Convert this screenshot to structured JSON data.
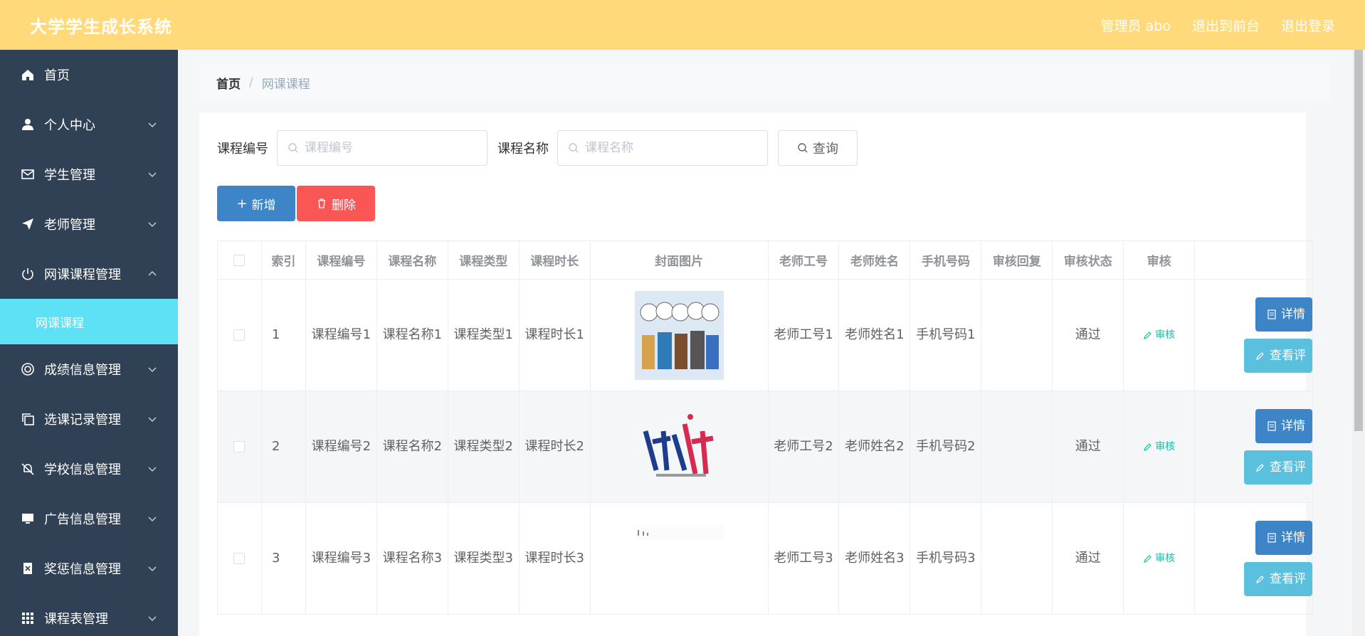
{
  "header": {
    "brand": "大学学生成长系统",
    "admin_label": "管理员 abo",
    "front_label": "退出到前台",
    "logout_label": "退出登录"
  },
  "sidebar": {
    "items": [
      {
        "label": "首页",
        "icon": "home-icon"
      },
      {
        "label": "个人中心",
        "icon": "user-icon"
      },
      {
        "label": "学生管理",
        "icon": "mail-icon"
      },
      {
        "label": "老师管理",
        "icon": "send-icon"
      },
      {
        "label": "网课课程管理",
        "icon": "power-icon"
      },
      {
        "label": "网课课程",
        "icon": ""
      },
      {
        "label": "成绩信息管理",
        "icon": "lifebuoy-icon"
      },
      {
        "label": "选课记录管理",
        "icon": "copy-icon"
      },
      {
        "label": "学校信息管理",
        "icon": "bell-off-icon"
      },
      {
        "label": "广告信息管理",
        "icon": "monitor-icon"
      },
      {
        "label": "奖惩信息管理",
        "icon": "delete-doc-icon"
      },
      {
        "label": "课程表管理",
        "icon": "grid-icon"
      }
    ]
  },
  "breadcrumb": {
    "home": "首页",
    "sep": "/",
    "current": "网课课程"
  },
  "search": {
    "code_label": "课程编号",
    "code_placeholder": "课程编号",
    "name_label": "课程名称",
    "name_placeholder": "课程名称",
    "query_label": "查询"
  },
  "actions": {
    "add_label": "新增",
    "delete_label": "删除"
  },
  "table": {
    "headers": [
      "索引",
      "课程编号",
      "课程名称",
      "课程类型",
      "课程时长",
      "封面图片",
      "老师工号",
      "老师姓名",
      "手机号码",
      "审核回复",
      "审核状态",
      "审核"
    ],
    "audit_link": "审核",
    "detail_label": "详情",
    "view_label": "查看评",
    "rows": [
      {
        "index": "1",
        "code": "课程编号1",
        "name": "课程名称1",
        "type": "课程类型1",
        "duration": "课程时长1",
        "teacher_no": "老师工号1",
        "teacher_name": "老师姓名1",
        "phone": "手机号码1",
        "reply": "",
        "status": "通过"
      },
      {
        "index": "2",
        "code": "课程编号2",
        "name": "课程名称2",
        "type": "课程类型2",
        "duration": "课程时长2",
        "teacher_no": "老师工号2",
        "teacher_name": "老师姓名2",
        "phone": "手机号码2",
        "reply": "",
        "status": "通过"
      },
      {
        "index": "3",
        "code": "课程编号3",
        "name": "课程名称3",
        "type": "课程类型3",
        "duration": "课程时长3",
        "teacher_no": "老师工号3",
        "teacher_name": "老师姓名3",
        "phone": "手机号码3",
        "reply": "",
        "status": "通过"
      }
    ]
  },
  "colors": {
    "header": "#ffd97a",
    "sidebar": "#304156",
    "active": "#5ee1f4",
    "primary": "#3d85c6",
    "danger": "#fb5656",
    "info": "#5bc0de",
    "success": "#13c2a3"
  }
}
